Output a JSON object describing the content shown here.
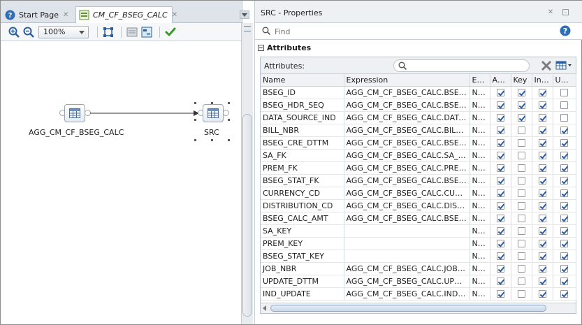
{
  "tabs": [
    {
      "label": "Start Page"
    },
    {
      "label": "CM_CF_BSEG_CALC"
    }
  ],
  "toolbar": {
    "zoom_value": "100%"
  },
  "canvas": {
    "source_node_label": "AGG_CM_CF_BSEG_CALC",
    "target_node_label": "SRC"
  },
  "properties": {
    "title": "SRC - Properties",
    "find_placeholder": "Find",
    "section_title": "Attributes",
    "attributes_label": "Attributes:",
    "columns": [
      "Name",
      "Expression",
      "Ex…",
      "Ac…",
      "Key",
      "In…",
      "Up…"
    ],
    "rows": [
      {
        "name": "BSEG_ID",
        "expr": "AGG_CM_CF_BSEG_CALC.BSEG_ID",
        "ex": "N…",
        "ac": true,
        "key": true,
        "in": true,
        "up": false
      },
      {
        "name": "BSEG_HDR_SEQ",
        "expr": "AGG_CM_CF_BSEG_CALC.BSEG_…",
        "ex": "N…",
        "ac": true,
        "key": true,
        "in": true,
        "up": false
      },
      {
        "name": "DATA_SOURCE_IND",
        "expr": "AGG_CM_CF_BSEG_CALC.DATA_…",
        "ex": "N…",
        "ac": true,
        "key": true,
        "in": true,
        "up": false
      },
      {
        "name": "BILL_NBR",
        "expr": "AGG_CM_CF_BSEG_CALC.BILL_N…",
        "ex": "N…",
        "ac": true,
        "key": false,
        "in": true,
        "up": true
      },
      {
        "name": "BSEG_CRE_DTTM",
        "expr": "AGG_CM_CF_BSEG_CALC.BSEG_…",
        "ex": "N…",
        "ac": true,
        "key": false,
        "in": true,
        "up": true
      },
      {
        "name": "SA_FK",
        "expr": "AGG_CM_CF_BSEG_CALC.SA_FK",
        "ex": "N…",
        "ac": true,
        "key": false,
        "in": true,
        "up": true
      },
      {
        "name": "PREM_FK",
        "expr": "AGG_CM_CF_BSEG_CALC.PREM_FK",
        "ex": "N…",
        "ac": true,
        "key": false,
        "in": true,
        "up": true
      },
      {
        "name": "BSEG_STAT_FK",
        "expr": "AGG_CM_CF_BSEG_CALC.BSEG_…",
        "ex": "N…",
        "ac": true,
        "key": false,
        "in": true,
        "up": true
      },
      {
        "name": "CURRENCY_CD",
        "expr": "AGG_CM_CF_BSEG_CALC.CURR…",
        "ex": "N…",
        "ac": true,
        "key": false,
        "in": true,
        "up": true
      },
      {
        "name": "DISTRIBUTION_CD",
        "expr": "AGG_CM_CF_BSEG_CALC.DISTR…",
        "ex": "N…",
        "ac": true,
        "key": false,
        "in": true,
        "up": true
      },
      {
        "name": "BSEG_CALC_AMT",
        "expr": "AGG_CM_CF_BSEG_CALC.BSEG_…",
        "ex": "N…",
        "ac": true,
        "key": false,
        "in": true,
        "up": true
      },
      {
        "name": "SA_KEY",
        "expr": "",
        "ex": "N…",
        "ac": true,
        "key": false,
        "in": true,
        "up": true
      },
      {
        "name": "PREM_KEY",
        "expr": "",
        "ex": "N…",
        "ac": true,
        "key": false,
        "in": true,
        "up": true
      },
      {
        "name": "BSEG_STAT_KEY",
        "expr": "",
        "ex": "N…",
        "ac": true,
        "key": false,
        "in": true,
        "up": true
      },
      {
        "name": "JOB_NBR",
        "expr": "AGG_CM_CF_BSEG_CALC.JOB_NBR",
        "ex": "N…",
        "ac": true,
        "key": false,
        "in": true,
        "up": true
      },
      {
        "name": "UPDATE_DTTM",
        "expr": "AGG_CM_CF_BSEG_CALC.UPDAT…",
        "ex": "N…",
        "ac": true,
        "key": false,
        "in": true,
        "up": true
      },
      {
        "name": "IND_UPDATE",
        "expr": "AGG_CM_CF_BSEG_CALC.IND_U…",
        "ex": "N…",
        "ac": true,
        "key": false,
        "in": true,
        "up": true
      }
    ]
  },
  "colors": {
    "accent": "#2a5aa0",
    "validate_check": "#3a9a2a"
  }
}
